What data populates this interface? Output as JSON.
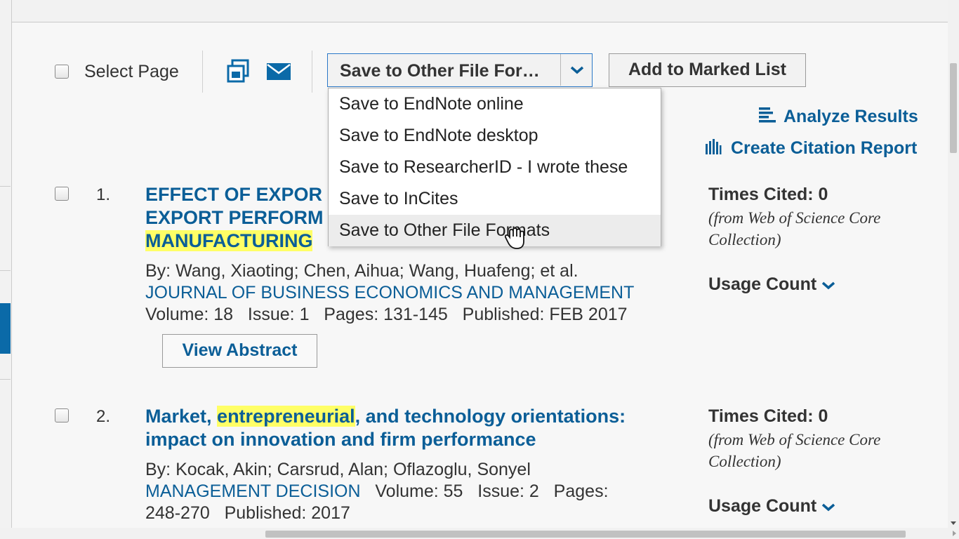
{
  "toolbar": {
    "select_page_label": "Select Page",
    "save_select_value": "Save to Other File For…",
    "add_to_marked_list_label": "Add to Marked List",
    "print_icon": "print-icon",
    "email_icon": "email-icon"
  },
  "save_dropdown": {
    "options": [
      "Save to EndNote online",
      "Save to EndNote desktop",
      "Save to ResearcherID - I wrote these",
      "Save to InCites",
      "Save to Other File Formats"
    ],
    "hovered_option": "Save to Other File Formats"
  },
  "side_links": {
    "analyze_results": "Analyze Results",
    "create_citation_report": "Create Citation Report"
  },
  "records": [
    {
      "number": "1.",
      "title_line1": "EFFECT OF EXPOR",
      "title_line2": "EXPORT PERFORM",
      "title_line3_highlight": "MANUFACTURING",
      "authors": "By: Wang, Xiaoting; Chen, Aihua; Wang, Huafeng; et al.",
      "journal": "JOURNAL OF BUSINESS ECONOMICS AND MANAGEMENT",
      "details": "Volume: 18   Issue: 1   Pages: 131-145   Published: FEB 2017",
      "view_abstract": "View Abstract",
      "times_cited": "Times Cited: 0",
      "times_cited_source": "(from Web of Science Core Collection)",
      "usage_count": "Usage Count"
    },
    {
      "number": "2.",
      "title_part1": "Market, ",
      "title_highlight": "entrepreneurial",
      "title_part2": ", and technology orientations:",
      "title_line2": "impact on innovation and firm performance",
      "authors": "By: Kocak, Akin; Carsrud, Alan; Oflazoglu, Sonyel",
      "journal": "MANAGEMENT DECISION",
      "details_line1": "   Volume: 55   Issue: 2   Pages:",
      "details_line2": "248-270   Published: 2017",
      "times_cited": "Times Cited: 0",
      "times_cited_source": "(from Web of Science Core Collection)",
      "usage_count": "Usage Count"
    }
  ],
  "colors": {
    "link": "#0b5e97",
    "highlight": "#ffff66",
    "focus_border": "#2a78c8"
  }
}
